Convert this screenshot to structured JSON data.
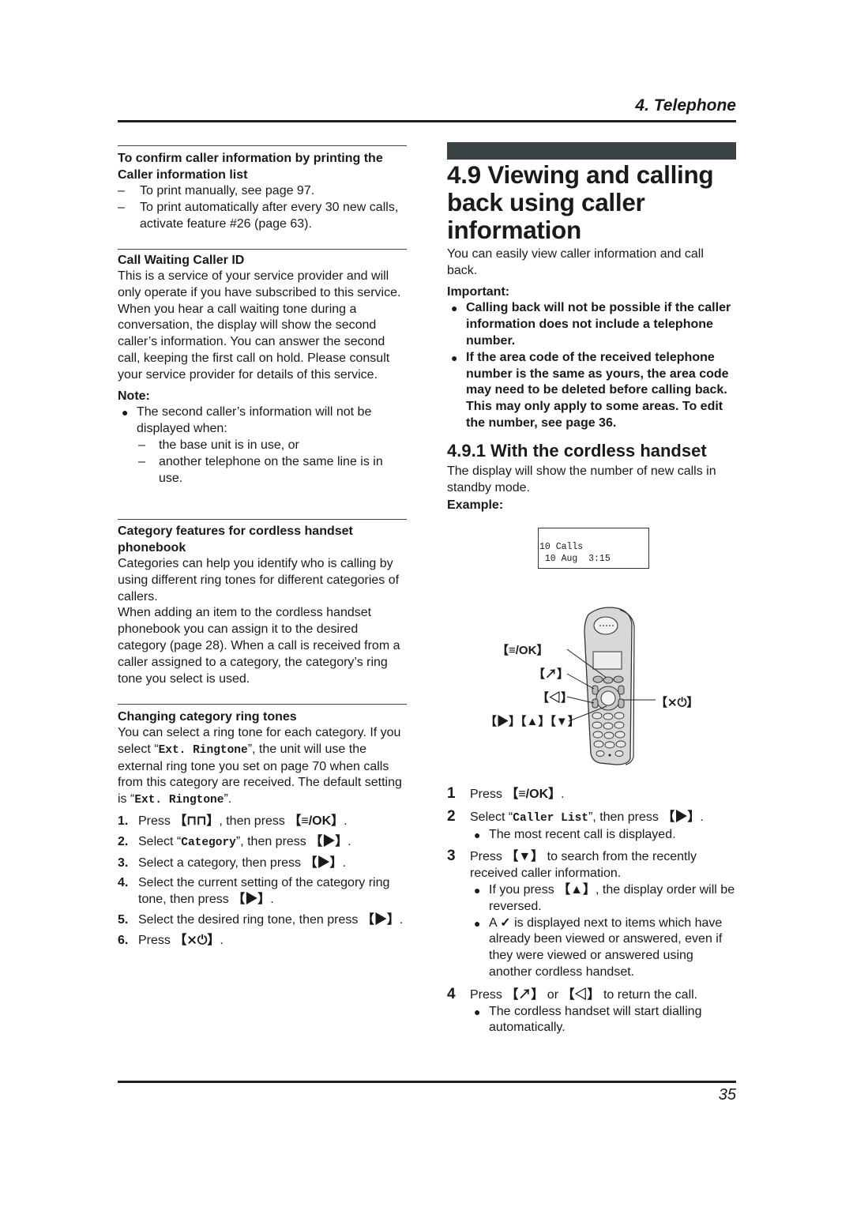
{
  "header": {
    "chapter_title": "4. Telephone"
  },
  "footer": {
    "page_number": "35"
  },
  "left": {
    "print_section": {
      "heading": "To confirm caller information by printing the Caller information list",
      "items": [
        "To print manually, see page 97.",
        "To print automatically after every 30 new calls, activate feature #26 (page 63)."
      ]
    },
    "call_waiting": {
      "heading": "Call Waiting Caller ID",
      "body": "This is a service of your service provider and will only operate if you have subscribed to this service. When you hear a call waiting tone during a conversation, the display will show the second caller’s information. You can answer the second call, keeping the first call on hold. Please consult your service provider for details of this service.",
      "note_label": "Note:",
      "note_bullet": "The second caller’s information will not be displayed when:",
      "note_subitems": [
        "the base unit is in use, or",
        "another telephone on the same line is in use."
      ]
    },
    "category_features": {
      "heading": "Category features for cordless handset phonebook",
      "body1": "Categories can help you identify who is calling by using different ring tones for different categories of callers.",
      "body2": "When adding an item to the cordless handset phonebook you can assign it to the desired category (page 28). When a call is received from a caller assigned to a category, the category’s ring tone you select is used."
    },
    "changing_ring": {
      "heading": "Changing category ring tones",
      "body_part1": "You can select a ring tone for each category. If you select “",
      "body_code1": "Ext. Ringtone",
      "body_part2": "”, the unit will use the external ring tone you set on page 70 when calls from this category are received. The default setting is “",
      "body_code2": "Ext. Ringtone",
      "body_part3": "”.",
      "steps": [
        {
          "num": "1.",
          "pre": "Press ",
          "key1": "【⊓⊓】",
          "mid": ", then press ",
          "key2": "【≡/OK】",
          "post": "."
        },
        {
          "num": "2.",
          "pre": "Select “",
          "code": "Category",
          "mid": "”, then press ",
          "key": "【▶】",
          "post": "."
        },
        {
          "num": "3.",
          "text": "Select a category, then press ",
          "key": "【▶】",
          "post": "."
        },
        {
          "num": "4.",
          "text": "Select the current setting of the category ring tone, then press ",
          "key": "【▶】",
          "post": "."
        },
        {
          "num": "5.",
          "text": "Select the desired ring tone, then press ",
          "key": "【▶】",
          "post": "."
        },
        {
          "num": "6.",
          "text": "Press ",
          "key": "【⨯⏻】",
          "post": "."
        }
      ]
    }
  },
  "right": {
    "section_title": "4.9 Viewing and calling back using caller information",
    "intro": "You can easily view caller information and call back.",
    "important_label": "Important:",
    "important_items": [
      "Calling back will not be possible if the caller information does not include a telephone number.",
      "If the area code of the received telephone number is the same as yours, the area code may need to be deleted before calling back. This may only apply to some areas. To edit the number, see page 36."
    ],
    "subsection_title": "4.9.1 With the cordless handset",
    "subsection_intro": "The display will show the number of new calls in standby mode.",
    "example_label": "Example:",
    "lcd": {
      "line1": "10 Calls",
      "line2": " 10 Aug  3:15"
    },
    "callouts": {
      "menu_ok": "【≡/OK】",
      "talk": "【↗】",
      "speaker": "【◁】",
      "nav": "【▶】【▲】【▼】",
      "off_power": "【⨯⏻】"
    },
    "steps": {
      "s1": {
        "num": "1",
        "pre": "Press ",
        "key": "【≡/OK】",
        "post": "."
      },
      "s2": {
        "num": "2",
        "pre": "Select “",
        "code": "Caller List",
        "mid": "”, then press ",
        "key": "【▶】",
        "post": ".",
        "bullet": "The most recent call is displayed."
      },
      "s3": {
        "num": "3",
        "pre": "Press ",
        "key": "【▼】",
        "post": " to search from the recently received caller information.",
        "bullet1_pre": "If you press ",
        "bullet1_key": "【▲】",
        "bullet1_post": ", the display order will be reversed.",
        "bullet2_pre": "A ",
        "bullet2_check": "✓",
        "bullet2_post": " is displayed next to items which have already been viewed or answered, even if they were viewed or answered using another cordless handset."
      },
      "s4": {
        "num": "4",
        "pre": "Press ",
        "key1": "【↗】",
        "mid": " or ",
        "key2": "【◁】",
        "post": " to return the call.",
        "bullet": "The cordless handset will start dialling automatically."
      }
    }
  }
}
